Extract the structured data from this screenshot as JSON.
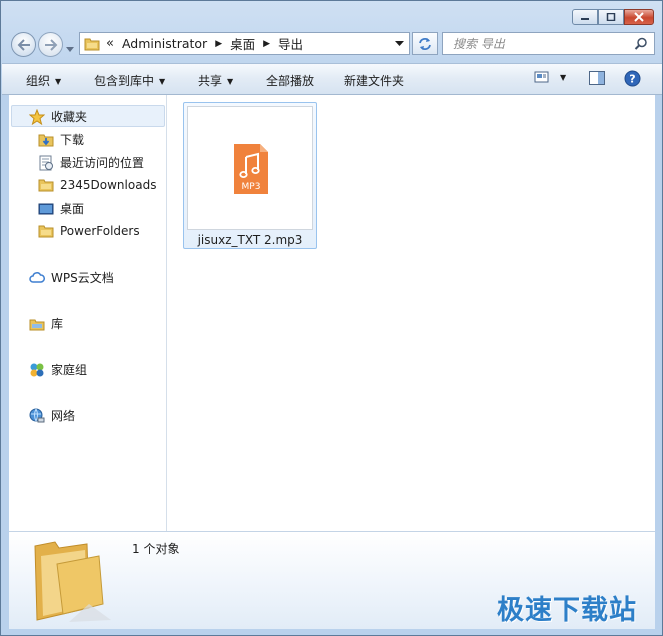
{
  "address": {
    "overflow": "«",
    "segments": [
      "Administrator",
      "桌面",
      "导出"
    ]
  },
  "search": {
    "placeholder": "搜索 导出"
  },
  "toolbar": {
    "organize": "组织",
    "include_in_library": "包含到库中",
    "share": "共享",
    "play_all": "全部播放",
    "new_folder": "新建文件夹"
  },
  "nav": {
    "favorites": "收藏夹",
    "downloads": "下载",
    "recent": "最近访问的位置",
    "downloads2345": "2345Downloads",
    "desktop": "桌面",
    "powerfolders": "PowerFolders",
    "wps": "WPS云文档",
    "libraries": "库",
    "homegroup": "家庭组",
    "network": "网络"
  },
  "file": {
    "name": "jisuxz_TXT 2.mp3",
    "badge": "MP3"
  },
  "status": {
    "count": "1 个对象"
  },
  "watermark": "极速下载站",
  "colors": {
    "accent": "#2d7fc8",
    "mp3": "#f0823c",
    "selection": "#99c3ee"
  }
}
